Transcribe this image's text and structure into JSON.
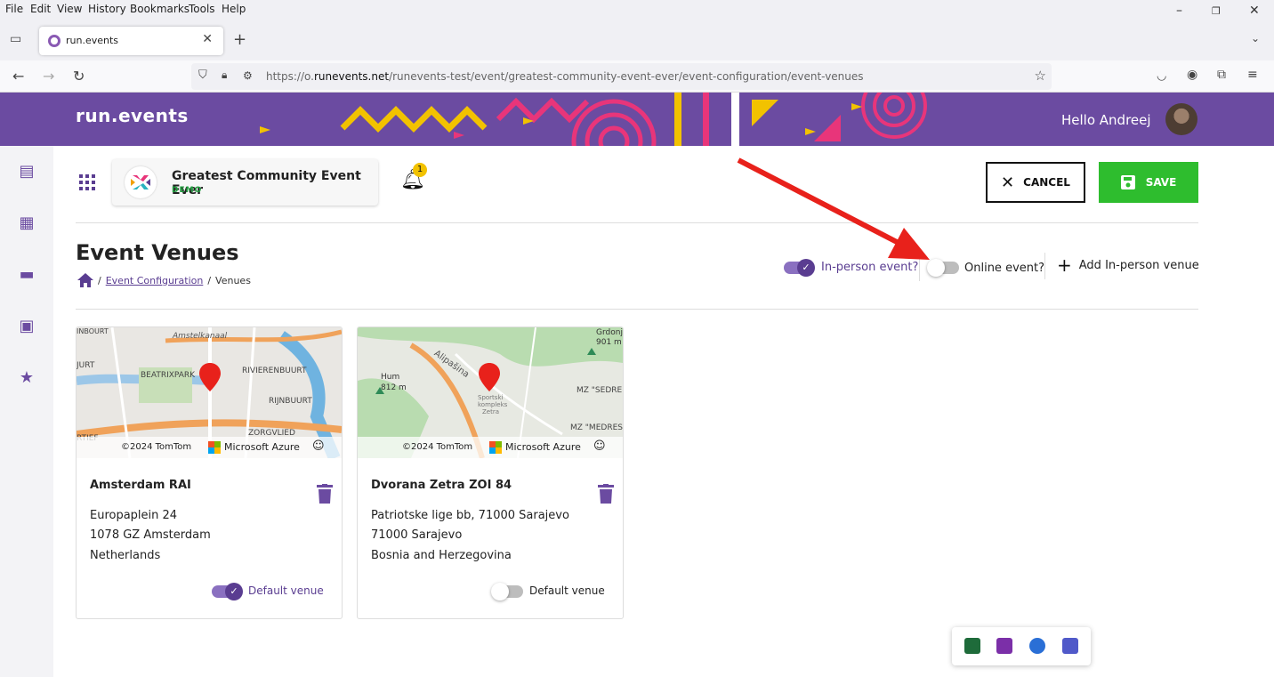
{
  "browser": {
    "menu": [
      "File",
      "Edit",
      "View",
      "History",
      "Bookmarks",
      "Tools",
      "Help"
    ],
    "tab_title": "run.events",
    "url_prefix": "https://o.",
    "url_domain": "runevents.net",
    "url_path": "/runevents-test/event/greatest-community-event-ever/event-configuration/event-venues"
  },
  "banner": {
    "logo": "run.events",
    "greeting": "Hello Andreej"
  },
  "event": {
    "title": "Greatest Community Event Ever",
    "badge": "DEMO",
    "notifications": "1"
  },
  "actions": {
    "cancel": "CANCEL",
    "save": "SAVE"
  },
  "page": {
    "title": "Event Venues",
    "breadcrumb": [
      "Event Configuration",
      "Venues"
    ],
    "inperson_label": "In-person event?",
    "inperson_on": true,
    "online_label": "Online event?",
    "online_on": false,
    "add_venue": "Add In-person venue"
  },
  "venues": [
    {
      "name": "Amsterdam RAI",
      "address": [
        "Europaplein 24",
        "1078 GZ Amsterdam",
        "Netherlands"
      ],
      "default_label": "Default venue",
      "is_default": true,
      "map_copyright": "©2024 TomTom",
      "map_provider": "Microsoft Azure",
      "map_labels": [
        "Amstelkanaal",
        "RIVIERENBUURT",
        "BEATRIXPARK",
        "RIJNBUURT",
        "ZORGVLIED",
        "INBOURT",
        "JURT",
        "RTIEF"
      ]
    },
    {
      "name": "Dvorana Zetra ZOI 84",
      "address": [
        "Patriotske lige bb, 71000 Sarajevo",
        "71000 Sarajevo",
        "Bosnia and Herzegovina"
      ],
      "default_label": "Default venue",
      "is_default": false,
      "map_copyright": "©2024 TomTom",
      "map_provider": "Microsoft Azure",
      "map_labels": [
        "Alipašina",
        "Hum",
        "812 m",
        "Grdonj",
        "901 m",
        "MZ \"SEDRE",
        "MZ \"MEDRES",
        "Sportski",
        "kompleks",
        "Zetra"
      ]
    }
  ],
  "colors": {
    "brand": "#6b4ba1",
    "accent": "#5a3d91",
    "save": "#2ebd2e",
    "arrow": "#e8211b"
  }
}
